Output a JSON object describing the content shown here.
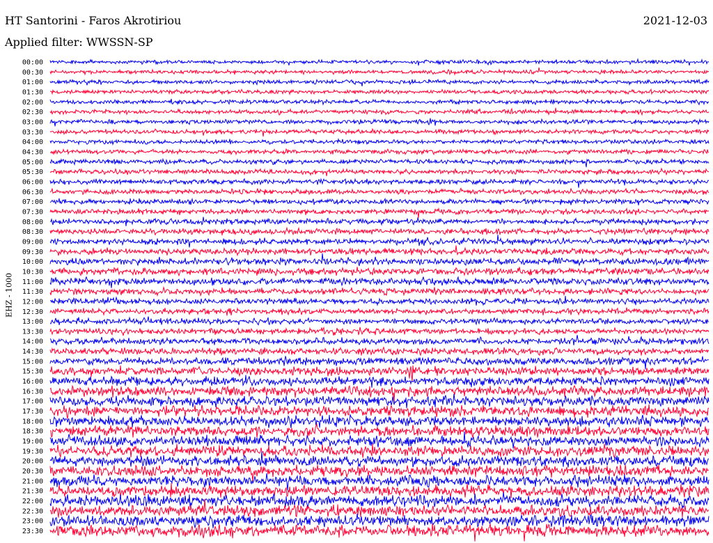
{
  "header": {
    "title": "HT Santorini - Faros Akrotiriou",
    "date": "2021-12-03",
    "filter": "Applied filter: WWSSN-SP"
  },
  "chart_data": {
    "type": "line",
    "ylabel": "EHZ - 1000",
    "tick_labels": [
      "00:00",
      "00:30",
      "01:00",
      "01:30",
      "02:00",
      "02:30",
      "03:00",
      "03:30",
      "04:00",
      "04:30",
      "05:00",
      "05:30",
      "06:00",
      "06:30",
      "07:00",
      "07:30",
      "08:00",
      "08:30",
      "09:00",
      "09:30",
      "10:00",
      "10:30",
      "11:00",
      "11:30",
      "12:00",
      "12:30",
      "13:00",
      "13:30",
      "14:00",
      "14:30",
      "15:00",
      "15:30",
      "16:00",
      "16:30",
      "17:00",
      "17:30",
      "18:00",
      "18:30",
      "19:00",
      "19:30",
      "20:00",
      "20:30",
      "21:00",
      "21:30",
      "22:00",
      "22:30",
      "23:00",
      "23:30"
    ],
    "trace_colors": [
      "#0000ee",
      "#ff0033"
    ],
    "noise_level": [
      0.3,
      0.3,
      0.32,
      0.32,
      0.33,
      0.33,
      0.34,
      0.34,
      0.35,
      0.36,
      0.37,
      0.38,
      0.39,
      0.4,
      0.41,
      0.42,
      0.43,
      0.45,
      0.47,
      0.49,
      0.52,
      0.54,
      0.55,
      0.5,
      0.46,
      0.44,
      0.45,
      0.46,
      0.5,
      0.54,
      0.58,
      0.62,
      0.7,
      0.75,
      0.78,
      0.8,
      0.8,
      0.8,
      0.81,
      0.82,
      0.82,
      0.83,
      0.84,
      0.85,
      0.86,
      0.86,
      0.87,
      0.88
    ],
    "events": [
      {
        "trace": 6,
        "position": 0.58,
        "amplitude": 1.4
      },
      {
        "trace": 25,
        "position": 0.27,
        "amplitude": 1.2
      },
      {
        "trace": 31,
        "position": 0.55,
        "amplitude": 1.8
      },
      {
        "trace": 31,
        "position": 0.58,
        "amplitude": 1.5
      }
    ],
    "random_seed": 20211203
  }
}
